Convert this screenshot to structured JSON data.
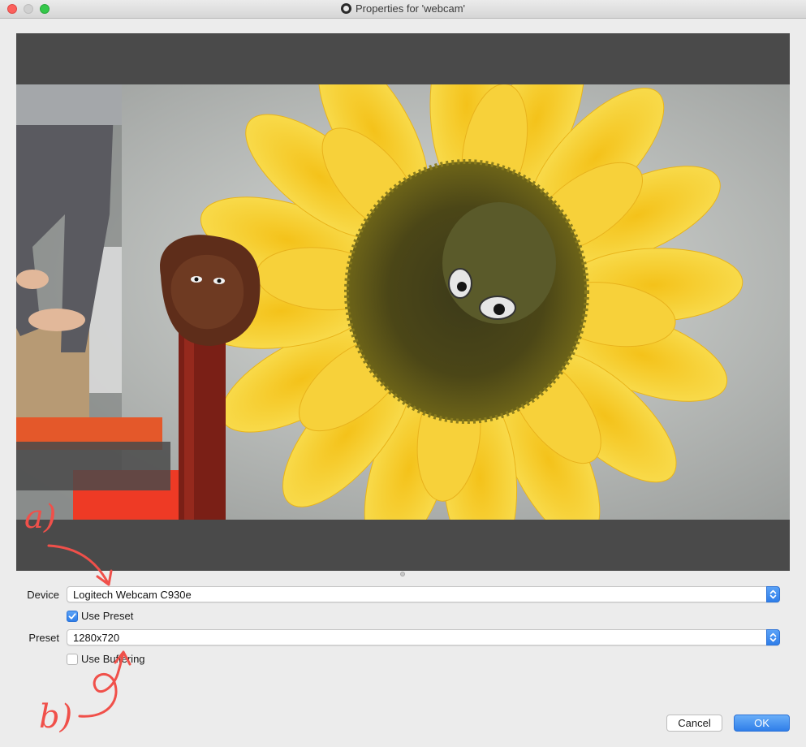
{
  "window": {
    "title": "Properties for 'webcam'",
    "controls": [
      "close",
      "minimize",
      "zoom"
    ]
  },
  "form": {
    "device_label": "Device",
    "device_value": "Logitech Webcam C930e",
    "use_preset_label": "Use Preset",
    "use_preset_checked": true,
    "preset_label": "Preset",
    "preset_value": "1280x720",
    "use_buffering_label": "Use Buffering",
    "use_buffering_checked": false
  },
  "buttons": {
    "cancel_label": "Cancel",
    "ok_label": "OK"
  },
  "annotations": {
    "a_label": "a)",
    "b_label": "b)"
  },
  "colors": {
    "accent": "#2f7ee9",
    "annotation": "#f0504a",
    "preview_bg": "#4a4a4a"
  }
}
